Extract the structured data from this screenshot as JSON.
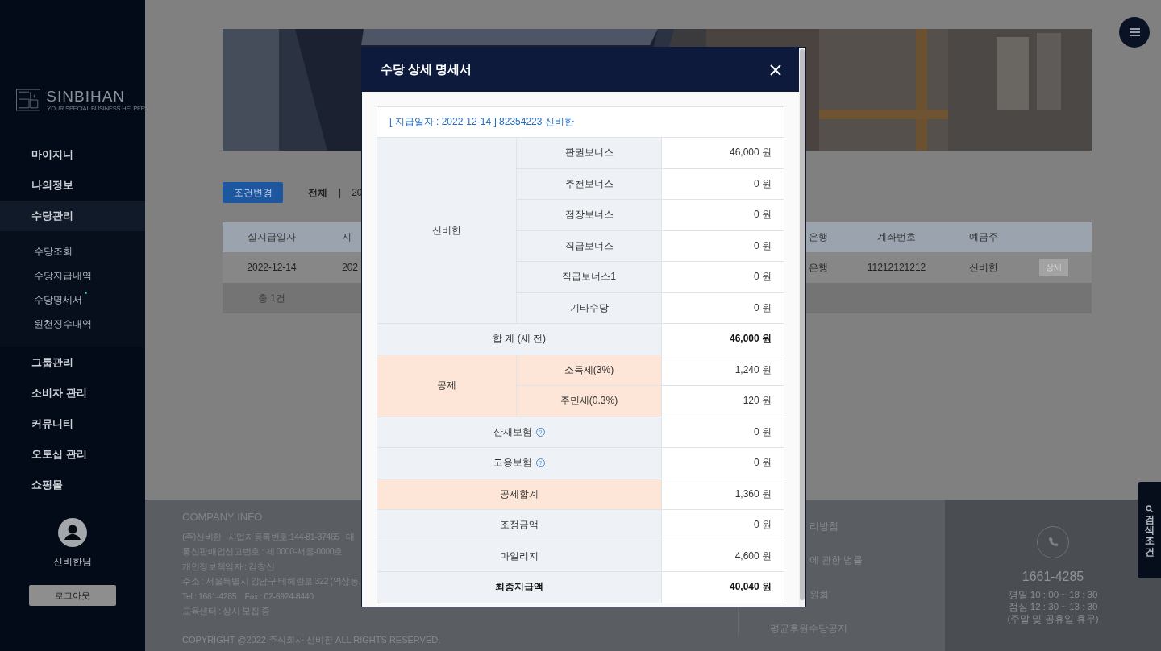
{
  "sidebar": {
    "logo": {
      "name": "SINBIHAN",
      "tagline": "YOUR SPECIAL BUSINESS HELPER"
    },
    "menu": [
      {
        "label": "마이지니",
        "selected": false
      },
      {
        "label": "나의정보",
        "selected": false
      },
      {
        "label": "수당관리",
        "selected": true,
        "children": [
          {
            "label": "수당조회",
            "marked": false
          },
          {
            "label": "수당지급내역",
            "marked": false
          },
          {
            "label": "수당명세서",
            "marked": true
          },
          {
            "label": "원천징수내역",
            "marked": false
          }
        ]
      },
      {
        "label": "그룹관리",
        "selected": false
      },
      {
        "label": "소비자 관리",
        "selected": false
      },
      {
        "label": "커뮤니티",
        "selected": false
      },
      {
        "label": "오토십 관리",
        "selected": false
      },
      {
        "label": "쇼핑몰",
        "selected": false
      }
    ],
    "user": {
      "name": "신비한님"
    },
    "logout": "로그아웃"
  },
  "toolbar": {
    "button": "조건변경",
    "filter": "전체",
    "separator": "|",
    "period": "20"
  },
  "table": {
    "columns": [
      "실지급일자",
      "지",
      "은행",
      "계좌번호",
      "예금주"
    ],
    "rows": [
      {
        "cells": [
          "2022-12-14",
          "202",
          "은행",
          "11212121212",
          "신비한"
        ],
        "action": "상세"
      }
    ],
    "summary": "총 1건"
  },
  "footer": {
    "title": "COMPANY INFO",
    "lines": [
      "(주)신비한   사업자등록번호:144-81-37465   대",
      "통신판매업신고번호 : 제 0000-서울-0000호",
      "개인정보책임자 : 김창신",
      "주소 : 서울특별시 강남구 테헤란로 322 (역삼동,",
      "Tel : 1661-4285    Fax : 02-6924-8440",
      "교육센터 : 상시 모집 중"
    ],
    "copyright": "COPYRIGHT @2022 주식회사 신비한 ALL RIGHTS RESERVED.",
    "links": [
      {
        "label": "리방침"
      },
      {
        "label": "에 관한 법률"
      },
      {
        "label": "원회"
      },
      {
        "label": "평균후원수당공지"
      }
    ],
    "phone": "1661-4285",
    "hours": [
      "평일 10 : 00 ~ 18 : 30",
      "점심 12 : 30 ~ 13 : 30",
      "(주말 및 공휴일 휴무)"
    ]
  },
  "side_tab": {
    "label": "검색조건"
  },
  "modal": {
    "title": "수당 상세 명세서",
    "caption": "[ 지급일자 : 2022-12-14 ] 82354223 신비한",
    "rows": [
      {
        "kind": "group",
        "label": "신비한",
        "color": "#eef2f6",
        "items": [
          {
            "label": "판권보너스",
            "amount": "46,000 원"
          },
          {
            "label": "추천보너스",
            "amount": "0 원"
          },
          {
            "label": "점장보너스",
            "amount": "0 원"
          },
          {
            "label": "직급보너스",
            "amount": "0 원"
          },
          {
            "label": "직급보너스1",
            "amount": "0 원"
          },
          {
            "label": "기타수당",
            "amount": "0 원"
          }
        ]
      },
      {
        "kind": "single",
        "label": "합 계 (세 전)",
        "amount": "46,000 원",
        "color": "#eef2f6",
        "bold": false,
        "amount_bold": true
      },
      {
        "kind": "group",
        "label": "공제",
        "color": "#fde6d7",
        "items": [
          {
            "label": "소득세(3%)",
            "amount": "1,240 원"
          },
          {
            "label": "주민세(0.3%)",
            "amount": "120 원"
          }
        ]
      },
      {
        "kind": "single",
        "label": "산재보험",
        "hint": "?",
        "amount": "0 원",
        "color": "#eef2f6",
        "bold": false,
        "amount_bold": false
      },
      {
        "kind": "single",
        "label": "고용보험",
        "hint": "?",
        "amount": "0 원",
        "color": "#eef2f6",
        "bold": false,
        "amount_bold": false
      },
      {
        "kind": "single",
        "label": "공제합계",
        "amount": "1,360 원",
        "color": "#fde6d7",
        "bold": false,
        "amount_bold": false
      },
      {
        "kind": "single",
        "label": "조정금액",
        "amount": "0 원",
        "color": "#eef2f6",
        "bold": false,
        "amount_bold": false
      },
      {
        "kind": "single",
        "label": "마일리지",
        "amount": "4,600 원",
        "color": "#eef2f6",
        "bold": false,
        "amount_bold": false
      },
      {
        "kind": "single",
        "label": "최종지급액",
        "amount": "40,040 원",
        "color": "#eef2f6",
        "bold": true,
        "amount_bold": true
      }
    ]
  }
}
